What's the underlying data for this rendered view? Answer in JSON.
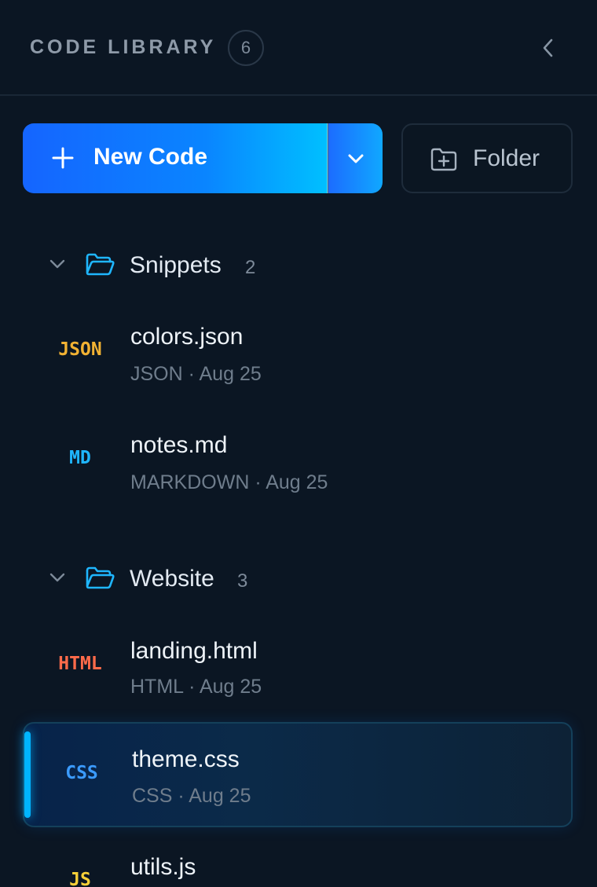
{
  "header": {
    "title": "CODE LIBRARY",
    "count": "6",
    "collapse_icon": "chevron-left-icon"
  },
  "actions": {
    "new_code_label": "New Code",
    "new_code_icon": "plus-icon",
    "dropdown_icon": "chevron-down-icon",
    "folder_label": "Folder",
    "folder_icon": "folder-plus-icon"
  },
  "colors": {
    "background": "#0b1623",
    "accent_start": "#1565ff",
    "accent_end": "#00c0ff",
    "json": "#f2b233",
    "md": "#1fb6ff",
    "html": "#ff6b4a",
    "css": "#3b9bff",
    "js": "#f7d038"
  },
  "folders": [
    {
      "name": "Snippets",
      "count": "2",
      "files": [
        {
          "badge": "JSON",
          "name": "colors.json",
          "meta": "JSON · Aug 25"
        },
        {
          "badge": "MD",
          "name": "notes.md",
          "meta": "MARKDOWN · Aug 25"
        }
      ]
    },
    {
      "name": "Website",
      "count": "3",
      "files": [
        {
          "badge": "HTML",
          "name": "landing.html",
          "meta": "HTML · Aug 25"
        },
        {
          "badge": "CSS",
          "name": "theme.css",
          "meta": "CSS · Aug 25",
          "selected": true
        },
        {
          "badge": "JS",
          "name": "utils.js",
          "meta": ""
        }
      ]
    }
  ]
}
